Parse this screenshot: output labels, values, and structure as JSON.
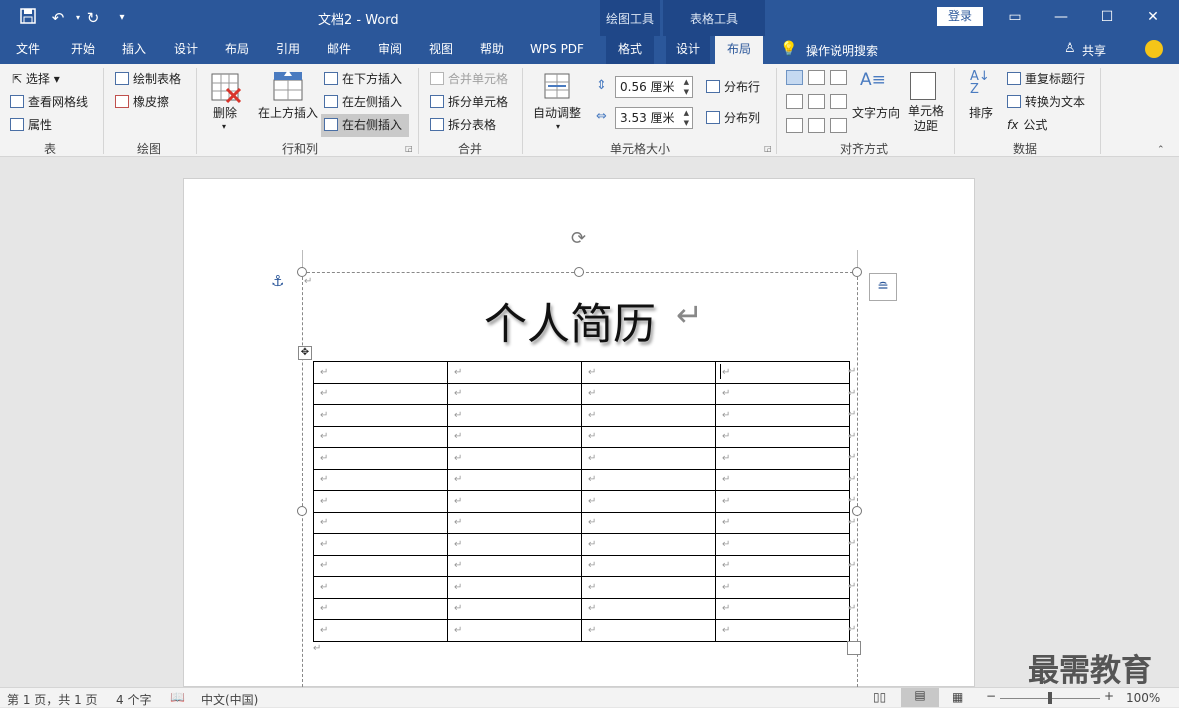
{
  "window": {
    "title": "文档2  -  Word",
    "login": "登录"
  },
  "context_groups": {
    "drawing": "绘图工具",
    "table": "表格工具"
  },
  "tabs": [
    "文件",
    "开始",
    "插入",
    "设计",
    "布局",
    "引用",
    "邮件",
    "审阅",
    "视图",
    "帮助",
    "WPS PDF",
    "格式",
    "设计",
    "布局"
  ],
  "tell_me": "操作说明搜索",
  "share": "共享",
  "ribbon": {
    "table_group": {
      "select": "选择",
      "gridlines": "查看网格线",
      "properties": "属性",
      "label": "表"
    },
    "draw_group": {
      "draw_table": "绘制表格",
      "eraser": "橡皮擦",
      "label": "绘图"
    },
    "rowcol_group": {
      "delete": "删除",
      "insert_above": "在上方插入",
      "insert_below": "在下方插入",
      "insert_left": "在左侧插入",
      "insert_right": "在右侧插入",
      "label": "行和列"
    },
    "merge_group": {
      "merge_cells": "合并单元格",
      "split_cells": "拆分单元格",
      "split_table": "拆分表格",
      "label": "合并"
    },
    "cellsize_group": {
      "autofit": "自动调整",
      "height": "0.56 厘米",
      "width": "3.53 厘米",
      "dist_rows": "分布行",
      "dist_cols": "分布列",
      "label": "单元格大小"
    },
    "align_group": {
      "text_direction": "文字方向",
      "cell_margins": "单元格边距",
      "label": "对齐方式"
    },
    "data_group": {
      "sort": "排序",
      "repeat_header": "重复标题行",
      "convert_text": "转换为文本",
      "formula": "公式",
      "label": "数据"
    }
  },
  "document": {
    "heading": "个人简历",
    "rows": 13,
    "cols": 4,
    "para_mark": "↵"
  },
  "status": {
    "page": "第 1 页，共 1 页",
    "words": "4 个字",
    "language": "中文(中国)",
    "zoom": "100%"
  },
  "watermark": "最需教育",
  "colors": {
    "brand": "#2b579a",
    "context": "#1f4788"
  }
}
